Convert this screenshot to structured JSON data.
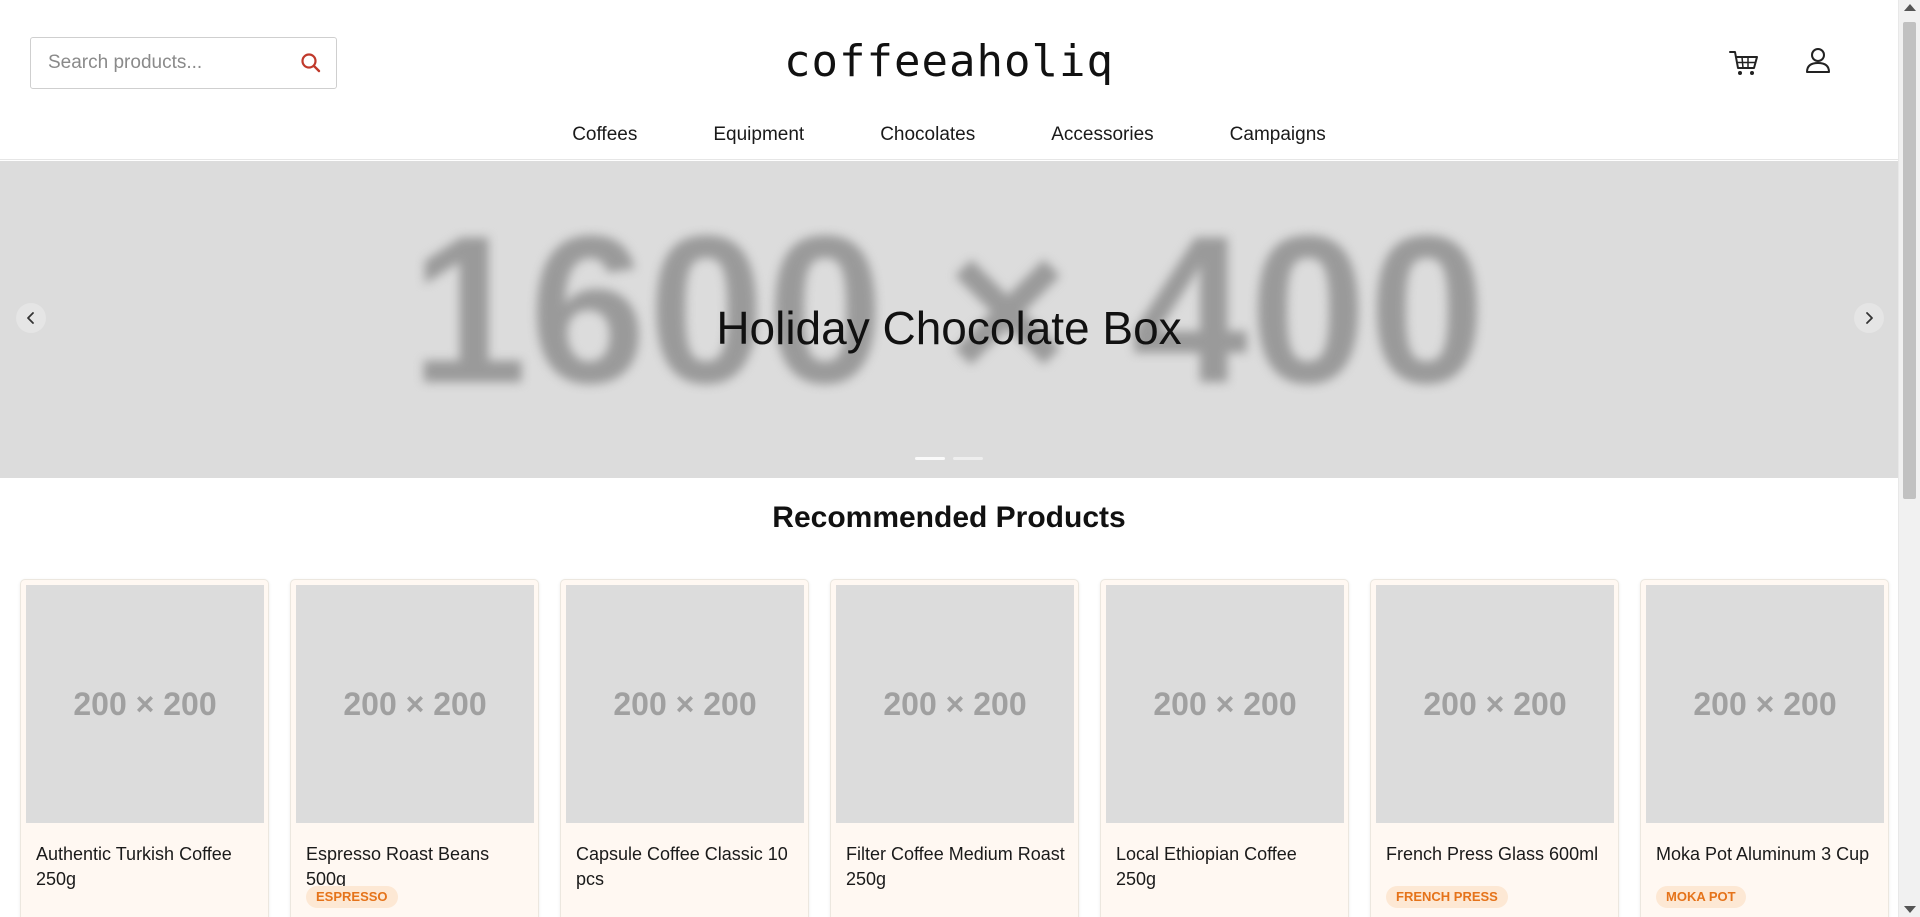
{
  "header": {
    "search_placeholder": "Search products...",
    "logo": "coffeeaholiq"
  },
  "nav": {
    "items": [
      "Coffees",
      "Equipment",
      "Chocolates",
      "Accessories",
      "Campaigns"
    ]
  },
  "hero": {
    "placeholder_text": "1600 × 400",
    "title": "Holiday Chocolate Box",
    "slide_count": 2,
    "active_slide": 1
  },
  "recommended": {
    "title": "Recommended Products",
    "products": [
      {
        "image_text": "200 × 200",
        "name": "Authentic Turkish Coffee 250g",
        "badge": ""
      },
      {
        "image_text": "200 × 200",
        "name": "Espresso Roast Beans 500g",
        "badge": "ESPRESSO"
      },
      {
        "image_text": "200 × 200",
        "name": "Capsule Coffee Classic 10 pcs",
        "badge": ""
      },
      {
        "image_text": "200 × 200",
        "name": "Filter Coffee Medium Roast 250g",
        "badge": ""
      },
      {
        "image_text": "200 × 200",
        "name": "Local Ethiopian Coffee 250g",
        "badge": ""
      },
      {
        "image_text": "200 × 200",
        "name": "French Press Glass 600ml",
        "badge": "FRENCH PRESS"
      },
      {
        "image_text": "200 × 200",
        "name": "Moka Pot Aluminum 3 Cup",
        "badge": "MOKA POT"
      }
    ]
  },
  "colors": {
    "accent": "#c0392b",
    "badge_text": "#e5731a",
    "badge_bg": "#fde8d4",
    "card_bg": "#fff8f2",
    "hero_bg": "#dcdcdc"
  },
  "icons": {
    "search": "search-icon",
    "cart": "cart-icon",
    "user": "user-icon",
    "prev": "chevron-left-icon",
    "next": "chevron-right-icon"
  }
}
